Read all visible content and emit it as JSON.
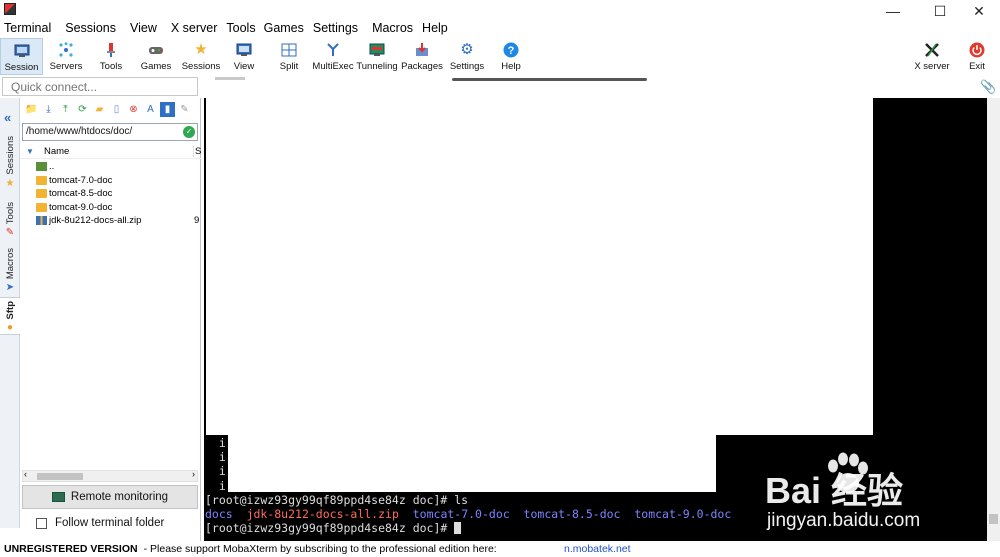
{
  "menu": {
    "items": [
      "Terminal",
      "Sessions",
      "View",
      "X server",
      "Tools",
      "Games",
      "Settings",
      "Macros",
      "Help"
    ]
  },
  "window_controls": {
    "minimize": "—",
    "maximize": "☐",
    "close": "✕"
  },
  "toolbar": {
    "buttons": [
      {
        "label": "Session",
        "icon": "session-icon"
      },
      {
        "label": "Servers",
        "icon": "servers-icon"
      },
      {
        "label": "Tools",
        "icon": "tools-icon"
      },
      {
        "label": "Games",
        "icon": "games-icon"
      },
      {
        "label": "Sessions",
        "icon": "star-icon"
      },
      {
        "label": "View",
        "icon": "view-icon"
      },
      {
        "label": "Split",
        "icon": "split-icon"
      },
      {
        "label": "MultiExec",
        "icon": "multiexec-icon"
      },
      {
        "label": "Tunneling",
        "icon": "tunneling-icon"
      },
      {
        "label": "Packages",
        "icon": "packages-icon"
      },
      {
        "label": "Settings",
        "icon": "settings-icon"
      },
      {
        "label": "Help",
        "icon": "help-icon"
      }
    ],
    "xserver_label": "X server",
    "exit_label": "Exit"
  },
  "quick_connect": {
    "placeholder": "Quick connect..."
  },
  "side_tabs": [
    "Sessions",
    "Tools",
    "Macros",
    "Sftp"
  ],
  "sftp": {
    "path": "/home/www/htdocs/doc/",
    "columns": {
      "name": "Name",
      "size": "S"
    },
    "files": [
      {
        "name": "..",
        "type": "up",
        "size": ""
      },
      {
        "name": "tomcat-7.0-doc",
        "type": "folder",
        "size": ""
      },
      {
        "name": "tomcat-8.5-doc",
        "type": "folder",
        "size": ""
      },
      {
        "name": "tomcat-9.0-doc",
        "type": "folder",
        "size": ""
      },
      {
        "name": "jdk-8u212-docs-all.zip",
        "type": "zip",
        "size": "9"
      }
    ],
    "remote_monitoring_label": "Remote monitoring",
    "follow_folder_label": "Follow terminal folder",
    "follow_folder_checked": false
  },
  "terminal": {
    "fragments": [
      "i",
      "i",
      "i",
      "i"
    ],
    "prompt1": "[root@izwz93gy99qf89ppd4se84z doc]# ls",
    "ls_output": [
      "docs",
      "jdk-8u212-docs-all.zip",
      "tomcat-7.0-doc",
      "tomcat-8.5-doc",
      "tomcat-9.0-doc"
    ],
    "prompt2": "[root@izwz93gy99qf89ppd4se84z doc]# "
  },
  "status": {
    "unregistered": "UNREGISTERED VERSION",
    "message": " -  Please support MobaXterm by subscribing to the professional edition here:",
    "link": "n.mobatek.net"
  },
  "watermark": {
    "brand": "Bai  经验",
    "url": "jingyan.baidu.com"
  },
  "colors": {
    "accent": "#2f6fc4",
    "terminal_bg": "#000000",
    "ls_dir": "#7b84ff",
    "ls_zip": "#ff6b5a"
  }
}
